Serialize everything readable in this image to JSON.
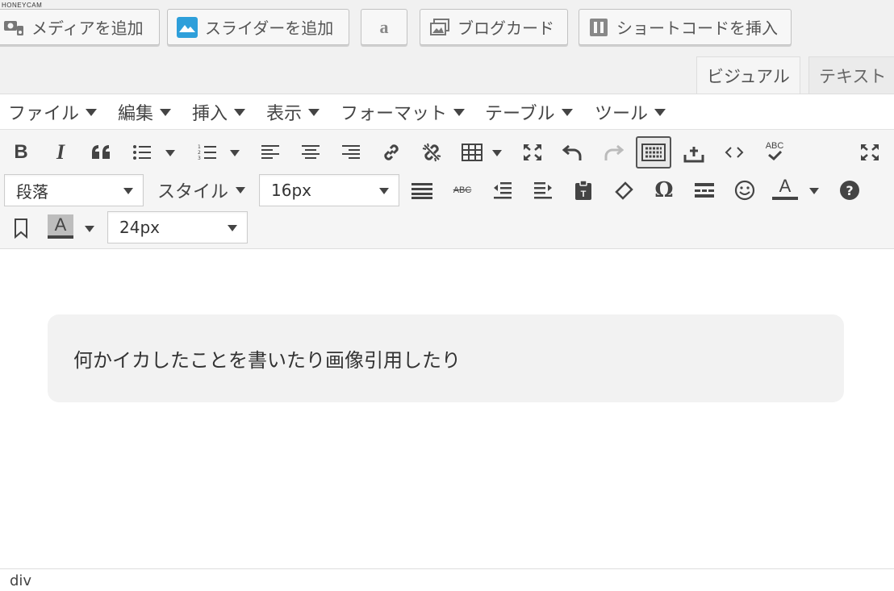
{
  "watermark": "HONEYCAM",
  "media_buttons": {
    "add_media": "メディアを追加",
    "add_slider": "スライダーを追加",
    "amazon_icon": "a",
    "blog_card": "ブログカード",
    "insert_shortcode": "ショートコードを挿入"
  },
  "tabs": {
    "visual": "ビジュアル",
    "text": "テキスト"
  },
  "menubar": {
    "file": "ファイル",
    "edit": "編集",
    "insert": "挿入",
    "view": "表示",
    "format": "フォーマット",
    "table": "テーブル",
    "tools": "ツール"
  },
  "toolbar": {
    "block_format": "段落",
    "style": "スタイル",
    "font_size": "16px",
    "font_size_2": "24px",
    "bold": "B",
    "italic": "I",
    "quote": "66",
    "spellcheck": "ABC",
    "strikethrough": "ABC",
    "omega": "Ω",
    "text_color": "A",
    "bg_color": "A",
    "help": "?"
  },
  "content": {
    "quote_text": "何かイカしたことを書いたり画像引用したり"
  },
  "statusbar": {
    "path": "div"
  },
  "colors": {
    "accent": "#2e9fda",
    "toolbar_bg": "#f5f5f5",
    "quote_bg": "#f2f2f2"
  }
}
